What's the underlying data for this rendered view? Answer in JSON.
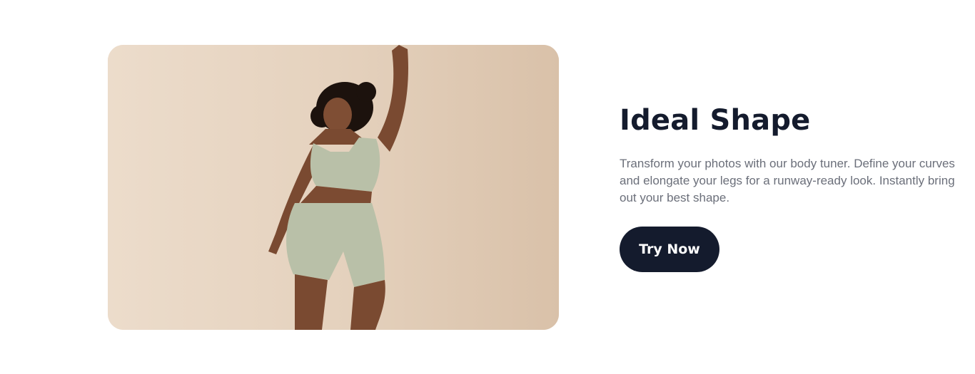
{
  "feature": {
    "title": "Ideal Shape",
    "description": "Transform your photos with our body tuner. Define your curves and elongate your legs for a runway-ready look. Instantly bring out your best shape.",
    "cta_label": "Try Now"
  },
  "image": {
    "alt": "Woman in sage green sports bra and bike shorts dancing against a beige background"
  },
  "colors": {
    "title": "#141b2d",
    "body_text": "#6b6f7a",
    "button_bg": "#141b2d",
    "button_text": "#ffffff",
    "photo_bg": "#e4d0bc",
    "outfit": "#b9c0a8"
  }
}
